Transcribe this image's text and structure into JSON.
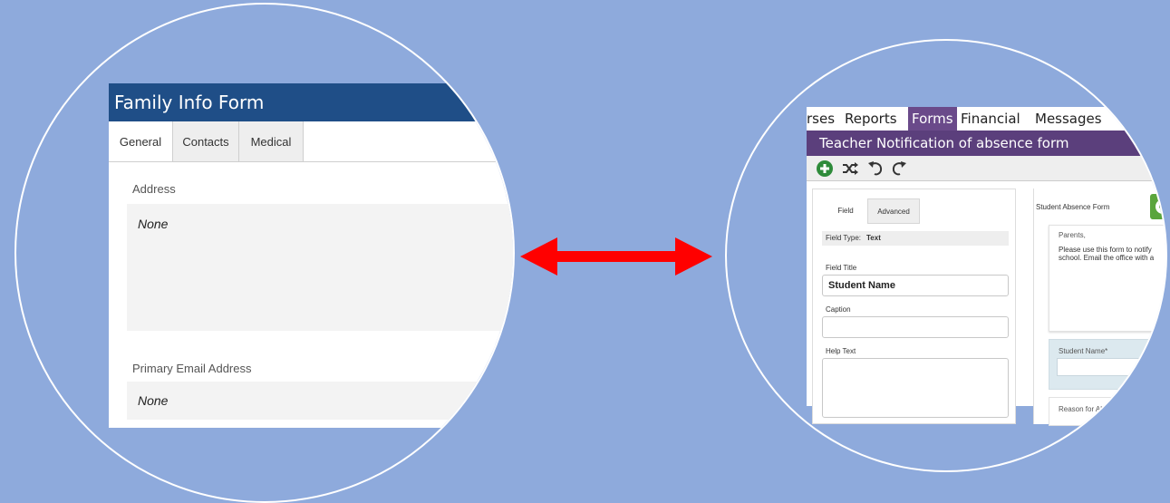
{
  "left_zoom": {
    "header_title": "Family Info Form",
    "tabs": [
      {
        "label": "General",
        "active": true
      },
      {
        "label": "Contacts",
        "active": false
      },
      {
        "label": "Medical",
        "active": false
      }
    ],
    "fields": [
      {
        "label": "Address",
        "value": "None"
      },
      {
        "label": "Primary Email Address",
        "value": "None"
      }
    ]
  },
  "right_zoom": {
    "menu": [
      {
        "label": "rses",
        "active": false
      },
      {
        "label": "Reports",
        "active": false
      },
      {
        "label": "Forms",
        "active": true
      },
      {
        "label": "Financial",
        "active": false
      },
      {
        "label": "Messages",
        "active": false
      }
    ],
    "form_title": "Teacher Notification of absence form",
    "toolbar": [
      "add-icon",
      "shuffle-icon",
      "undo-icon",
      "redo-icon"
    ],
    "editor_tabs": [
      {
        "label": "Field",
        "active": true
      },
      {
        "label": "Advanced",
        "active": false
      }
    ],
    "field_type_label": "Field Type:",
    "field_type_value": "Text",
    "field_title_label": "Field Title",
    "field_title_value": "Student Name",
    "caption_label": "Caption",
    "caption_value": "",
    "help_text_label": "Help Text",
    "help_text_value": "",
    "preview_form_title": "Student Absence Form",
    "preview_greeting": "Parents,",
    "preview_body_line1": "Please use this form to notify",
    "preview_body_line2": "school. Email the office with a",
    "preview_field_label": "Student Name*",
    "preview_next_field_label": "Reason for Ab",
    "colors": {
      "menu_active": "#6a4a8a",
      "title_bar": "#5b3f7c",
      "add_green": "#2e8b3a"
    }
  },
  "connector": {
    "type": "double-headed-arrow",
    "color": "#ff0000"
  },
  "colors": {
    "background": "#8eaadc",
    "left_header": "#1f4e87"
  }
}
